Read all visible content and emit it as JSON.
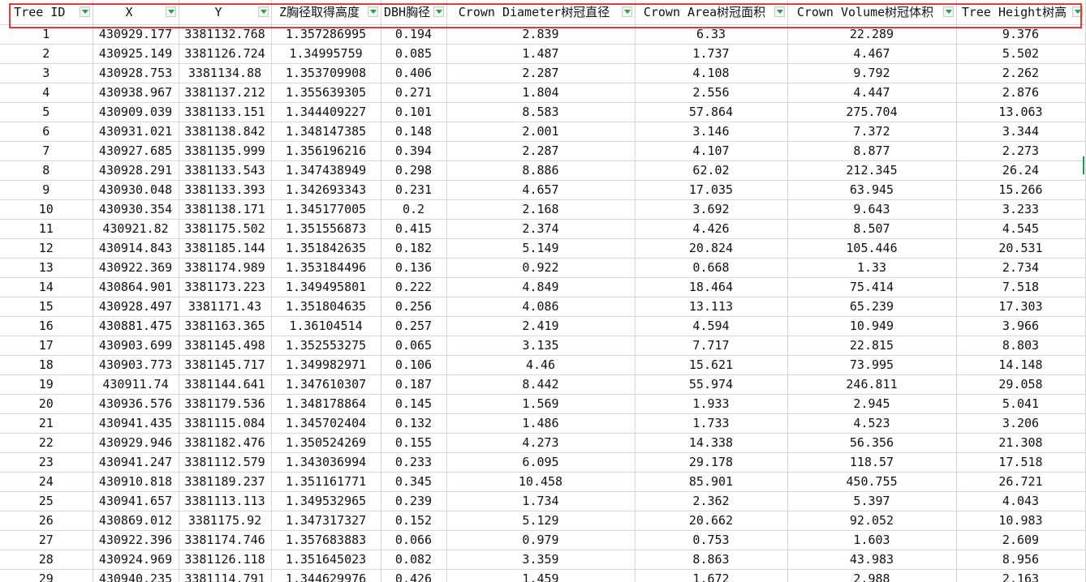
{
  "columns": [
    "Tree ID",
    "X",
    "Y",
    "Z胸径取得高度",
    "DBH胸径",
    "Crown Diameter树冠直径",
    "Crown Area树冠面积",
    "Crown Volume树冠体积",
    "Tree Height树高"
  ],
  "rows": [
    [
      "1",
      "430929.177",
      "3381132.768",
      "1.357286995",
      "0.194",
      "2.839",
      "6.33",
      "22.289",
      "9.376"
    ],
    [
      "2",
      "430925.149",
      "3381126.724",
      "1.34995759",
      "0.085",
      "1.487",
      "1.737",
      "4.467",
      "5.502"
    ],
    [
      "3",
      "430928.753",
      "3381134.88",
      "1.353709908",
      "0.406",
      "2.287",
      "4.108",
      "9.792",
      "2.262"
    ],
    [
      "4",
      "430938.967",
      "3381137.212",
      "1.355639305",
      "0.271",
      "1.804",
      "2.556",
      "4.447",
      "2.876"
    ],
    [
      "5",
      "430909.039",
      "3381133.151",
      "1.344409227",
      "0.101",
      "8.583",
      "57.864",
      "275.704",
      "13.063"
    ],
    [
      "6",
      "430931.021",
      "3381138.842",
      "1.348147385",
      "0.148",
      "2.001",
      "3.146",
      "7.372",
      "3.344"
    ],
    [
      "7",
      "430927.685",
      "3381135.999",
      "1.356196216",
      "0.394",
      "2.287",
      "4.107",
      "8.877",
      "2.273"
    ],
    [
      "8",
      "430928.291",
      "3381133.543",
      "1.347438949",
      "0.298",
      "8.886",
      "62.02",
      "212.345",
      "26.24"
    ],
    [
      "9",
      "430930.048",
      "3381133.393",
      "1.342693343",
      "0.231",
      "4.657",
      "17.035",
      "63.945",
      "15.266"
    ],
    [
      "10",
      "430930.354",
      "3381138.171",
      "1.345177005",
      "0.2",
      "2.168",
      "3.692",
      "9.643",
      "3.233"
    ],
    [
      "11",
      "430921.82",
      "3381175.502",
      "1.351556873",
      "0.415",
      "2.374",
      "4.426",
      "8.507",
      "4.545"
    ],
    [
      "12",
      "430914.843",
      "3381185.144",
      "1.351842635",
      "0.182",
      "5.149",
      "20.824",
      "105.446",
      "20.531"
    ],
    [
      "13",
      "430922.369",
      "3381174.989",
      "1.353184496",
      "0.136",
      "0.922",
      "0.668",
      "1.33",
      "2.734"
    ],
    [
      "14",
      "430864.901",
      "3381173.223",
      "1.349495801",
      "0.222",
      "4.849",
      "18.464",
      "75.414",
      "7.518"
    ],
    [
      "15",
      "430928.497",
      "3381171.43",
      "1.351804635",
      "0.256",
      "4.086",
      "13.113",
      "65.239",
      "17.303"
    ],
    [
      "16",
      "430881.475",
      "3381163.365",
      "1.36104514",
      "0.257",
      "2.419",
      "4.594",
      "10.949",
      "3.966"
    ],
    [
      "17",
      "430903.699",
      "3381145.498",
      "1.352553275",
      "0.065",
      "3.135",
      "7.717",
      "22.815",
      "8.803"
    ],
    [
      "18",
      "430903.773",
      "3381145.717",
      "1.349982971",
      "0.106",
      "4.46",
      "15.621",
      "73.995",
      "14.148"
    ],
    [
      "19",
      "430911.74",
      "3381144.641",
      "1.347610307",
      "0.187",
      "8.442",
      "55.974",
      "246.811",
      "29.058"
    ],
    [
      "20",
      "430936.576",
      "3381179.536",
      "1.348178864",
      "0.145",
      "1.569",
      "1.933",
      "2.945",
      "5.041"
    ],
    [
      "21",
      "430941.435",
      "3381115.084",
      "1.345702404",
      "0.132",
      "1.486",
      "1.733",
      "4.523",
      "3.206"
    ],
    [
      "22",
      "430929.946",
      "3381182.476",
      "1.350524269",
      "0.155",
      "4.273",
      "14.338",
      "56.356",
      "21.308"
    ],
    [
      "23",
      "430941.247",
      "3381112.579",
      "1.343036994",
      "0.233",
      "6.095",
      "29.178",
      "118.57",
      "17.518"
    ],
    [
      "24",
      "430910.818",
      "3381189.237",
      "1.351161771",
      "0.345",
      "10.458",
      "85.901",
      "450.755",
      "26.721"
    ],
    [
      "25",
      "430941.657",
      "3381113.113",
      "1.349532965",
      "0.239",
      "1.734",
      "2.362",
      "5.397",
      "4.043"
    ],
    [
      "26",
      "430869.012",
      "3381175.92",
      "1.347317327",
      "0.152",
      "5.129",
      "20.662",
      "92.052",
      "10.983"
    ],
    [
      "27",
      "430922.396",
      "3381174.746",
      "1.357683883",
      "0.066",
      "0.979",
      "0.753",
      "1.603",
      "2.609"
    ],
    [
      "28",
      "430924.969",
      "3381126.118",
      "1.351645023",
      "0.082",
      "3.359",
      "8.863",
      "43.983",
      "8.956"
    ],
    [
      "29",
      "430940.235",
      "3381114.791",
      "1.344629976",
      "0.426",
      "1.459",
      "1.672",
      "2.988",
      "2.163"
    ]
  ],
  "colors": {
    "highlight_border": "#e53935",
    "filter_arrow": "#2a9d4b",
    "gridline": "#d4d4d4"
  }
}
